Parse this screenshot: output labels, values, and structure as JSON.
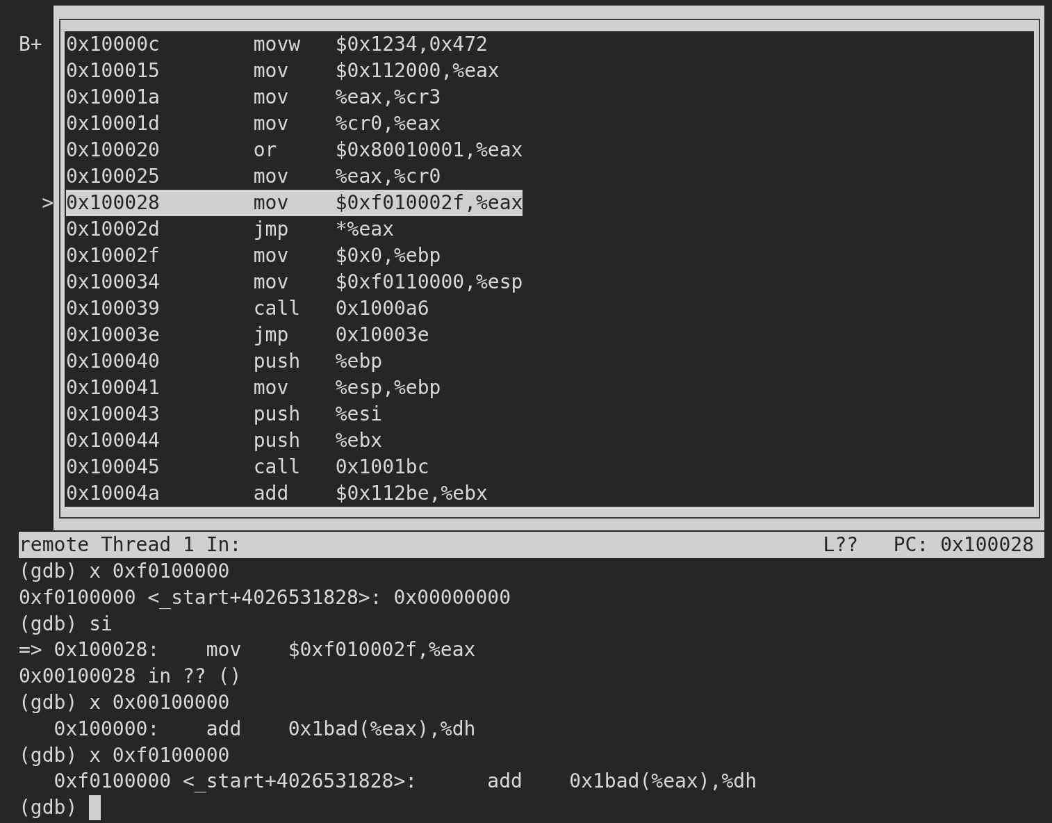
{
  "asm_window": {
    "rows": [
      {
        "breakpoint": "B+",
        "address": "0x10000c",
        "mnemonic": "movw",
        "operands": "$0x1234,0x472",
        "selected": false
      },
      {
        "address": "0x100015",
        "mnemonic": "mov",
        "operands": "$0x112000,%eax",
        "selected": false
      },
      {
        "address": "0x10001a",
        "mnemonic": "mov",
        "operands": "%eax,%cr3",
        "selected": false
      },
      {
        "address": "0x10001d",
        "mnemonic": "mov",
        "operands": "%cr0,%eax",
        "selected": false
      },
      {
        "address": "0x100020",
        "mnemonic": "or",
        "operands": "$0x80010001,%eax",
        "selected": false
      },
      {
        "address": "0x100025",
        "mnemonic": "mov",
        "operands": "%eax,%cr0",
        "selected": false
      },
      {
        "pointer": ">",
        "address": "0x100028",
        "mnemonic": "mov",
        "operands": "$0xf010002f,%eax",
        "selected": true
      },
      {
        "address": "0x10002d",
        "mnemonic": "jmp",
        "operands": "*%eax",
        "selected": false
      },
      {
        "address": "0x10002f",
        "mnemonic": "mov",
        "operands": "$0x0,%ebp",
        "selected": false
      },
      {
        "address": "0x100034",
        "mnemonic": "mov",
        "operands": "$0xf0110000,%esp",
        "selected": false
      },
      {
        "address": "0x100039",
        "mnemonic": "call",
        "operands": "0x1000a6",
        "selected": false
      },
      {
        "address": "0x10003e",
        "mnemonic": "jmp",
        "operands": "0x10003e",
        "selected": false
      },
      {
        "address": "0x100040",
        "mnemonic": "push",
        "operands": "%ebp",
        "selected": false
      },
      {
        "address": "0x100041",
        "mnemonic": "mov",
        "operands": "%esp,%ebp",
        "selected": false
      },
      {
        "address": "0x100043",
        "mnemonic": "push",
        "operands": "%esi",
        "selected": false
      },
      {
        "address": "0x100044",
        "mnemonic": "push",
        "operands": "%ebx",
        "selected": false
      },
      {
        "address": "0x100045",
        "mnemonic": "call",
        "operands": "0x1001bc",
        "selected": false
      },
      {
        "address": "0x10004a",
        "mnemonic": "add",
        "operands": "$0x112be,%ebx",
        "selected": false
      }
    ]
  },
  "status_bar": {
    "left": "remote Thread 1 In:",
    "line": "L??",
    "pc": "PC: 0x100028"
  },
  "console": {
    "lines": [
      "(gdb) x 0xf0100000",
      "0xf0100000 <_start+4026531828>: 0x00000000",
      "(gdb) si",
      "=> 0x100028:    mov    $0xf010002f,%eax",
      "0x00100028 in ?? ()",
      "(gdb) x 0x00100000",
      "   0x100000:    add    0x1bad(%eax),%dh",
      "(gdb) x 0xf0100000",
      "   0xf0100000 <_start+4026531828>:      add    0x1bad(%eax),%dh"
    ],
    "prompt": "(gdb)",
    "cursor": true
  }
}
